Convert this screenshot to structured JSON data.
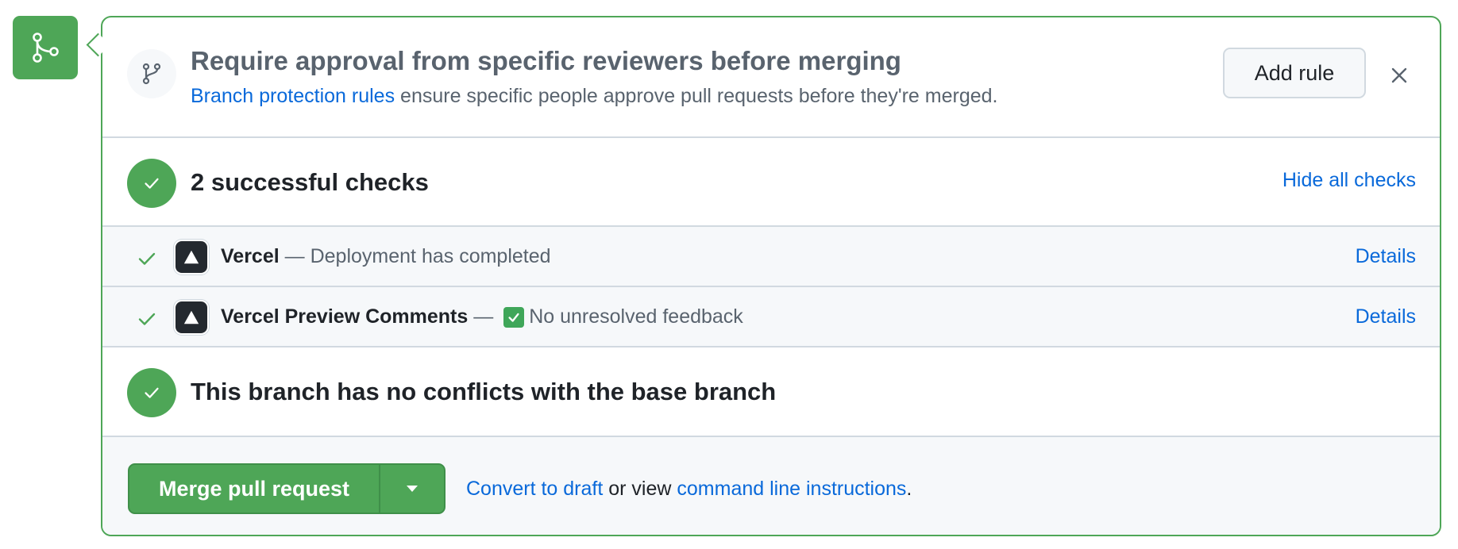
{
  "colors": {
    "success": "#4ea657",
    "link": "#0969da",
    "muted_text": "#59636e",
    "row_background": "#f6f8fa"
  },
  "approval": {
    "title": "Require approval from specific reviewers before merging",
    "link_text": "Branch protection rules",
    "description": " ensure specific people approve pull requests before they're merged.",
    "add_rule_label": "Add rule",
    "icon": "git-branch-icon"
  },
  "checks": {
    "summary": "2 successful checks",
    "toggle_label": "Hide all checks",
    "items": [
      {
        "name": "Vercel",
        "separator": " — ",
        "description": "Deployment has completed",
        "has_check_emoji": false,
        "details_label": "Details",
        "icon": "vercel-logo"
      },
      {
        "name": "Vercel Preview Comments",
        "separator": " — ",
        "description": "No unresolved feedback",
        "has_check_emoji": true,
        "details_label": "Details",
        "icon": "vercel-logo"
      }
    ]
  },
  "conflicts": {
    "text": "This branch has no conflicts with the base branch"
  },
  "merge": {
    "button_label": "Merge pull request",
    "convert_link": "Convert to draft",
    "middle_text": " or view ",
    "instructions_link": "command line instructions",
    "end_text": "."
  }
}
